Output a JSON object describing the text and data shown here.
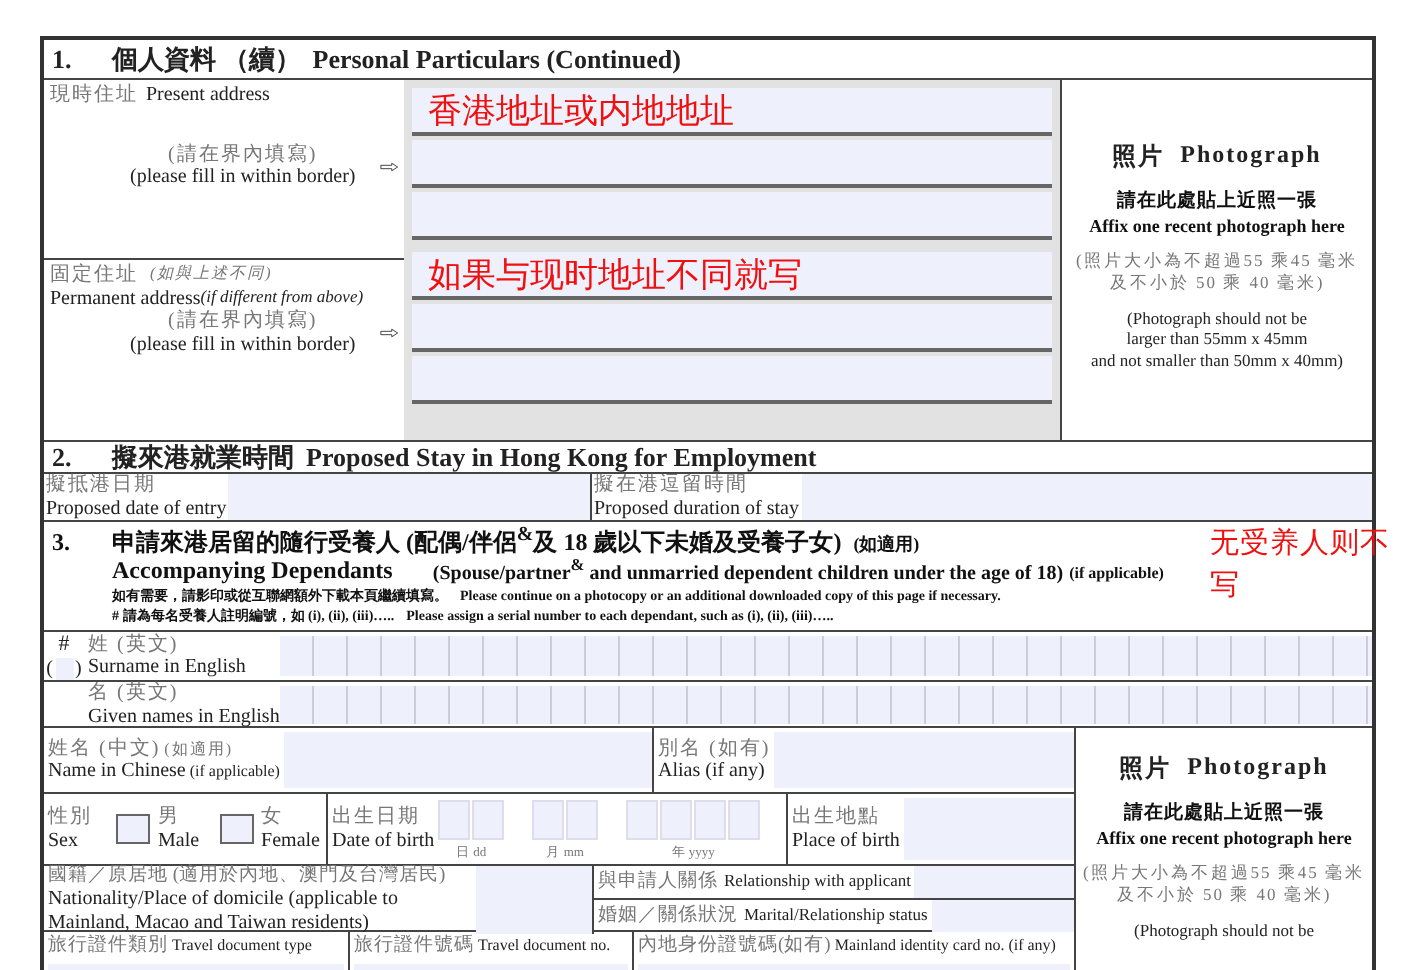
{
  "section1": {
    "number": "1.",
    "title_zh": "個人資料 （續）",
    "title_en": "Personal Particulars (Continued)",
    "present_address": {
      "label_zh": "現時住址",
      "label_en": "Present address",
      "hint_zh": "(請在界內填寫)",
      "hint_en": "(please fill in within border)",
      "value": "香港地址或内地地址"
    },
    "permanent_address": {
      "label_zh": "固定住址",
      "note_zh": "(如與上述不同)",
      "label_en": "Permanent address",
      "note_en": "(if different from above)",
      "hint_zh": "(請在界內填寫)",
      "hint_en": "(please fill in within border)",
      "value": "如果与现时地址不同就写"
    },
    "photo": {
      "title_zh": "照片",
      "title_en": "Photograph",
      "instruction_zh": "請在此處貼上近照一張",
      "instruction_en": "Affix one recent photograph here",
      "size_zh": [
        "(照片大小為不超過55 乘45 毫米",
        "及不小於 50 乘 40 毫米)"
      ],
      "size_en": [
        "(Photograph should not be",
        "larger than 55mm x 45mm",
        "and not smaller than 50mm x 40mm)"
      ]
    }
  },
  "section2": {
    "number": "2.",
    "title_zh": "擬來港就業時間",
    "title_en": "Proposed Stay in Hong Kong for Employment",
    "fields": [
      {
        "label_zh": "擬抵港日期",
        "label_en": "Proposed date of entry"
      },
      {
        "label_zh": "擬在港逗留時間",
        "label_en": "Proposed duration of stay"
      }
    ]
  },
  "section3": {
    "number": "3.",
    "title_zh": "申請來港居留的隨行受養人 (配偶/伴侶$^{&}$及 18 歲以下未婚及受養子女)",
    "applicable_zh": "(如適用)",
    "title_en": "Accompanying Dependants",
    "scope_en": "(Spouse/partner$^{&}$ and unmarried dependent children under the age of 18)",
    "applicable_en": "(if applicable)",
    "note_zh": "如有需要，請影印或從互聯網額外下載本頁繼續填寫。",
    "note_en": "Please continue on a photocopy or an additional downloaded copy of this page if necessary.",
    "serial_zh": "# 請為每名受養人註明編號，如 (i), (ii), (iii)…..",
    "serial_en": "Please assign a serial number to each dependant, such as (i), (ii), (iii)…..",
    "annotation": "无受养人则不写",
    "serial_mark": "#",
    "serial_open": "(",
    "serial_close": ")",
    "surname": {
      "label_zh": "姓 (英文)",
      "label_en": "Surname in English"
    },
    "given_names": {
      "label_zh": "名 (英文)",
      "label_en": "Given names in English"
    },
    "chinese_name": {
      "label_zh": "姓名 (中文)",
      "note_zh": "(如適用)",
      "label_en": "Name in Chinese",
      "note_en": "(if applicable)"
    },
    "alias": {
      "label_zh": "別名 (如有)",
      "label_en": "Alias (if any)"
    },
    "sex": {
      "label_zh": "性別",
      "label_en": "Sex",
      "options": [
        {
          "label_zh": "男",
          "label_en": "Male",
          "checked": false
        },
        {
          "label_zh": "女",
          "label_en": "Female",
          "checked": false
        }
      ]
    },
    "date_of_birth": {
      "label_zh": "出生日期",
      "label_en": "Date of birth",
      "parts": [
        {
          "kind": "day",
          "caption": "日 dd"
        },
        {
          "kind": "month",
          "caption": "月 mm"
        },
        {
          "kind": "year",
          "caption": "年 yyyy"
        }
      ]
    },
    "place_of_birth": {
      "label_zh": "出生地點",
      "label_en": "Place of birth"
    },
    "nationality": {
      "label_zh": "國籍／原居地 (適用於內地、澳門及台灣居民)",
      "label_en": "Nationality/Place of domicile (applicable to Mainland, Macao and Taiwan residents)"
    },
    "relationship": {
      "label_zh": "與申請人關係",
      "label_en": "Relationship with applicant"
    },
    "marital_status": {
      "label_zh": "婚姻／關係狀況",
      "label_en": "Marital/Relationship status"
    },
    "travel_documents": [
      {
        "label_zh": "旅行證件類別",
        "label_en": "Travel document type"
      },
      {
        "label_zh": "旅行證件號碼",
        "label_en": "Travel document no."
      },
      {
        "label_zh": "內地身份證號碼(如有)",
        "label_en": "Mainland identity card no. (if any)"
      }
    ],
    "photo": {
      "title_zh": "照片",
      "title_en": "Photograph",
      "instruction_zh": "請在此處貼上近照一張",
      "instruction_en": "Affix one recent photograph here",
      "size_zh": [
        "(照片大小為不超過55 乘45 毫米",
        "及不小於 50 乘 40 毫米)"
      ],
      "size_en": [
        "(Photograph should not be"
      ]
    }
  }
}
